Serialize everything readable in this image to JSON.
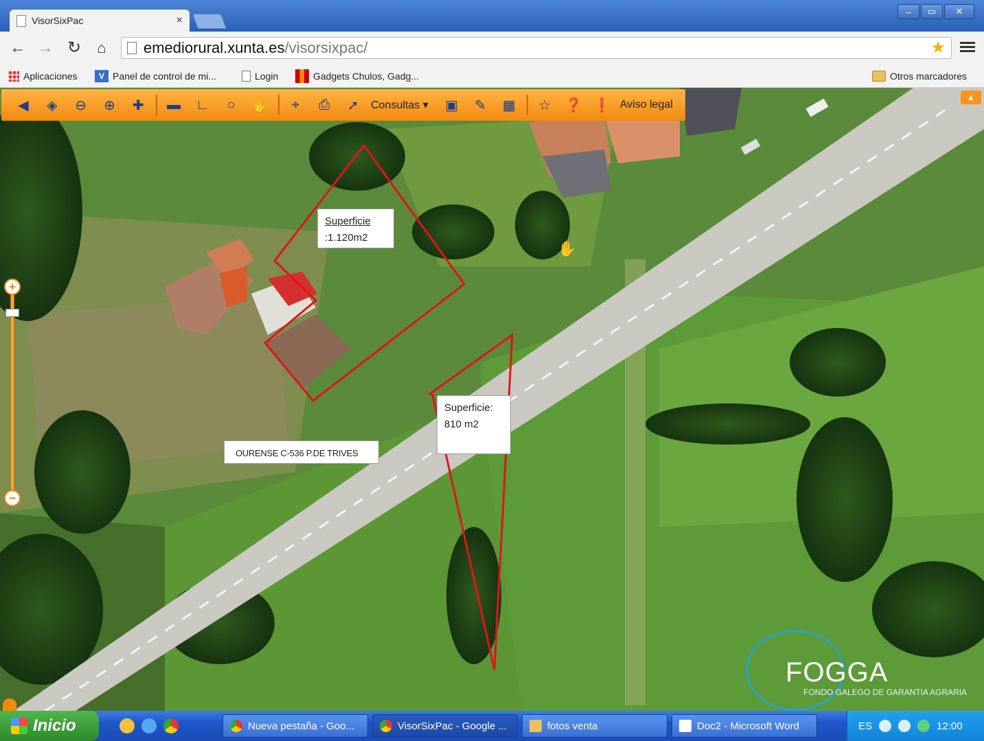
{
  "browser": {
    "tab_title": "VisorSixPac",
    "tab_close": "×",
    "url_host": "emediorural.xunta.es",
    "url_path": "/visorsixpac/",
    "window_controls": {
      "minimize": "–",
      "maximize": "▭",
      "close": "✕"
    },
    "bookmarks": [
      {
        "label": "Aplicaciones",
        "icon": "apps-icon"
      },
      {
        "label": "Panel de control de mi...",
        "icon": "v-icon"
      },
      {
        "label": "Login",
        "icon": "page-icon"
      },
      {
        "label": "Gadgets Chulos, Gadg...",
        "icon": "gadgets-icon"
      }
    ],
    "other_bookmarks": "Otros marcadores"
  },
  "toolbar": {
    "consultas_label": "Consultas",
    "aviso_label": "Aviso legal",
    "accent": "#f28a10"
  },
  "map": {
    "parcel_1": {
      "label": "Superficie",
      "value": ":1.120m2"
    },
    "parcel_2": {
      "label": "Superficie:",
      "value": "810 m2"
    },
    "road_label": "OURENSE C-536 P.DE TRIVES",
    "logo_name": "FOGGA",
    "logo_sub": "FONDO GALEGO DE GARANTIA AGRARIA",
    "parcel_color": "#e0151b"
  },
  "taskbar": {
    "start_label": "Inicio",
    "items": [
      "Nueva pestaña - Goo...",
      "VisorSixPac - Google ...",
      "fotos venta",
      "Doc2 - Microsoft Word"
    ],
    "language": "ES",
    "clock": "12:00"
  }
}
